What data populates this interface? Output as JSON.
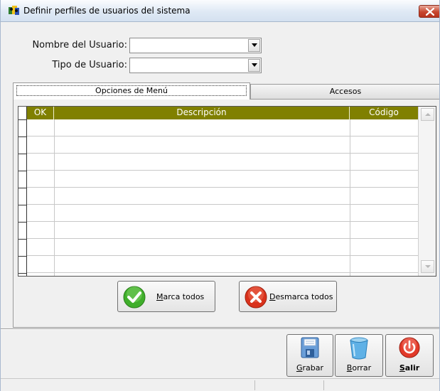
{
  "window": {
    "title": "Definir perfiles de usuarios del sistema"
  },
  "form": {
    "user_name_label": "Nombre del Usuario:",
    "user_name_value": "",
    "user_type_label": "Tipo de Usuario:",
    "user_type_value": ""
  },
  "tabs": [
    {
      "label": "Opciones de Menú",
      "active": true
    },
    {
      "label": "Accesos",
      "active": false
    }
  ],
  "grid": {
    "columns": [
      "OK",
      "Descripción",
      "Código"
    ],
    "header_color": "#808000",
    "rows": []
  },
  "actions": {
    "mark_all_prefix": "",
    "mark_all_hotkey": "M",
    "mark_all_rest": "arca todos",
    "unmark_all_prefix": "",
    "unmark_all_hotkey": "D",
    "unmark_all_rest": "esmarca todos"
  },
  "toolbar": {
    "save_hotkey": "G",
    "save_rest": "rabar",
    "delete_hotkey": "B",
    "delete_rest": "orrar",
    "exit_hotkey": "S",
    "exit_rest": "alir"
  },
  "colors": {
    "accent_green": "#3fae2a",
    "accent_red": "#d9321c"
  }
}
